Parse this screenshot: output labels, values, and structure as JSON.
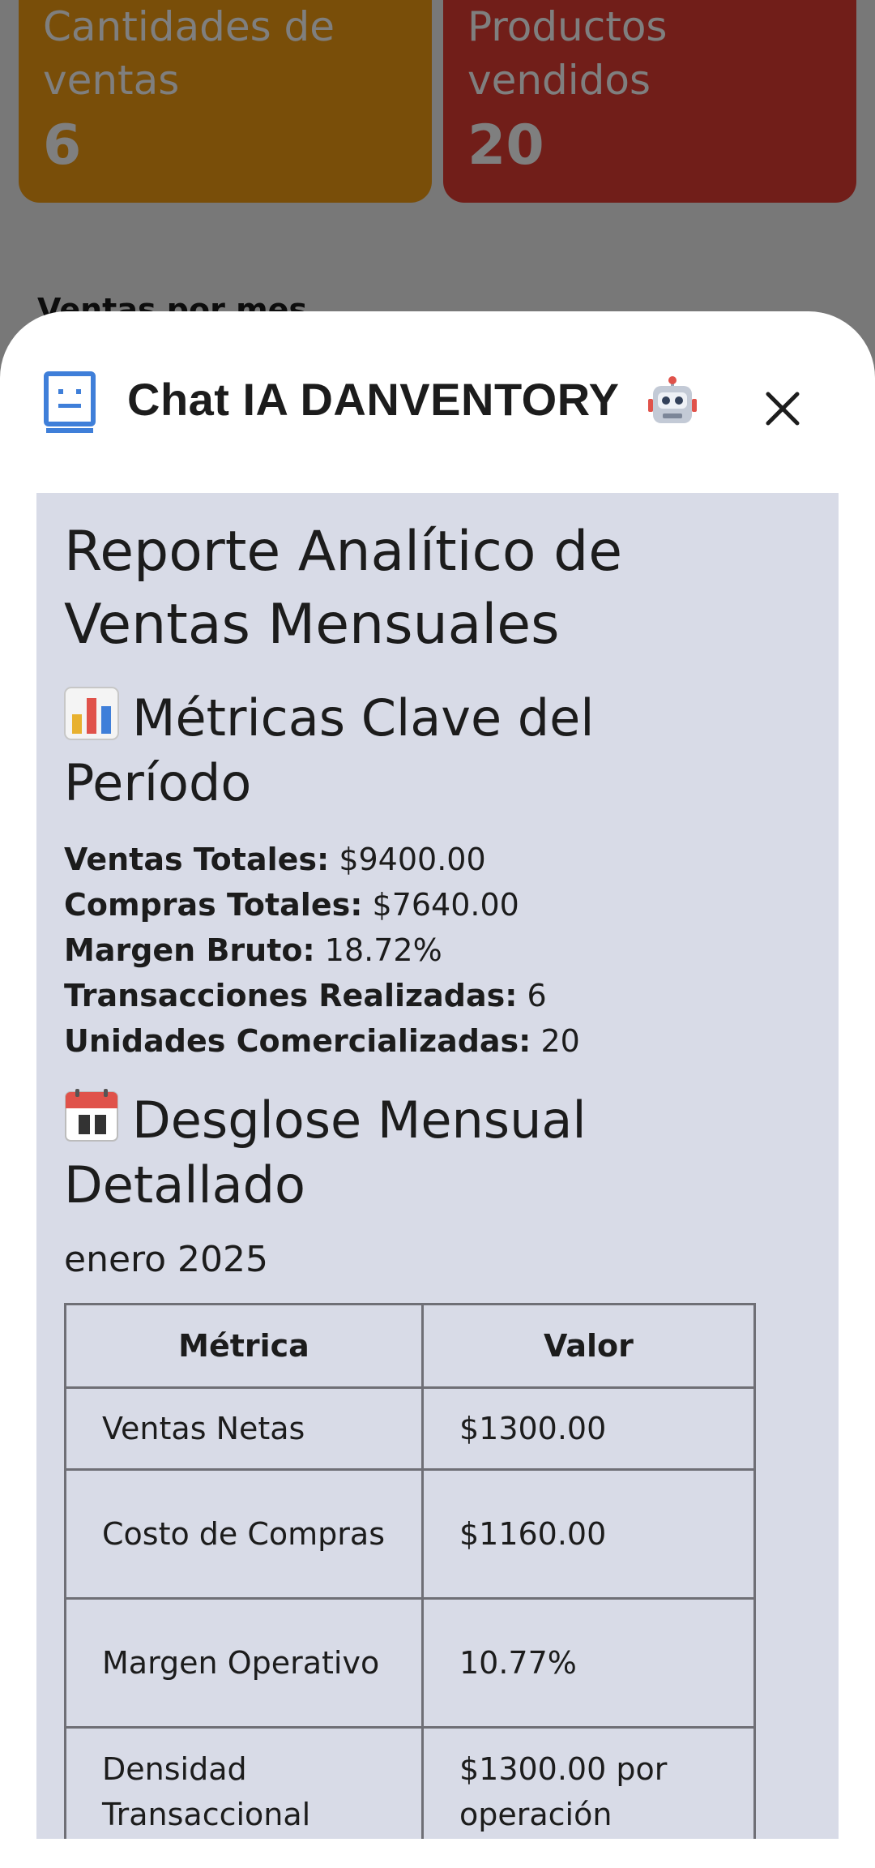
{
  "background": {
    "cards": [
      {
        "title": "Cantidades de ventas",
        "value": "6",
        "color": "#f39c12"
      },
      {
        "title": "Productos vendidos",
        "value": "20",
        "color": "#e23c33"
      }
    ],
    "section_heading": "Ventas por mes"
  },
  "sheet": {
    "title": "Chat IA DANVENTORY",
    "title_icon": "document-bot-icon",
    "title_emoji": "robot-emoji",
    "close_icon": "close-icon"
  },
  "report": {
    "title": "Reporte Analítico de Ventas Mensuales",
    "metrics_heading": "Métricas Clave del Período",
    "metrics": [
      {
        "label": "Ventas Totales:",
        "value": "$9400.00"
      },
      {
        "label": "Compras Totales:",
        "value": "$7640.00"
      },
      {
        "label": "Margen Bruto:",
        "value": "18.72%"
      },
      {
        "label": "Transacciones Realizadas:",
        "value": "6"
      },
      {
        "label": "Unidades Comercializadas:",
        "value": "20"
      }
    ],
    "breakdown_heading": "Desglose Mensual Detallado",
    "month": "enero 2025",
    "table": {
      "headers": [
        "Métrica",
        "Valor"
      ],
      "rows": [
        [
          "Ventas Netas",
          "$1300.00"
        ],
        [
          "Costo de Compras",
          "$1160.00"
        ],
        [
          "Margen Operativo",
          "10.77%"
        ],
        [
          "Densidad Transaccional",
          "$1300.00 por operación"
        ]
      ]
    }
  },
  "colors": {
    "accent_blue": "#3f7fd9",
    "panel": "#d8dbe7"
  }
}
